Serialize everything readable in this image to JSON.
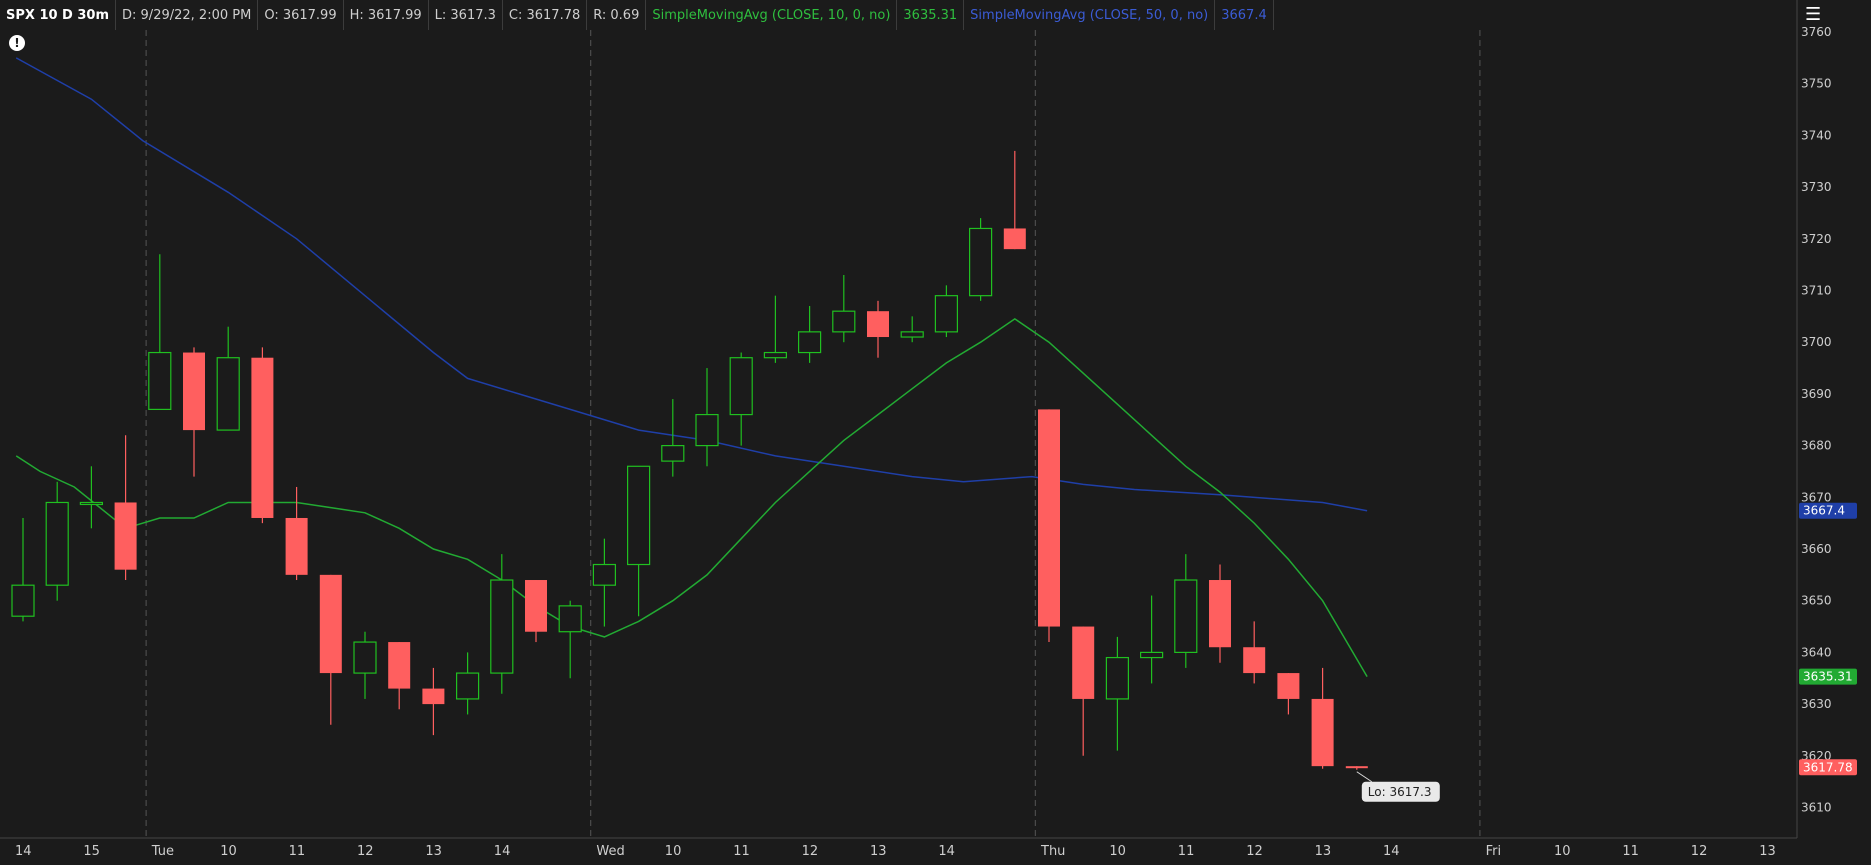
{
  "header": {
    "symbol": "SPX 10 D 30m",
    "date": "D: 9/29/22, 2:00 PM",
    "open": "O: 3617.99",
    "high": "H: 3617.99",
    "low": "L: 3617.3",
    "close": "C: 3617.78",
    "range": "R: 0.69",
    "sma10_label": "SimpleMovingAvg (CLOSE, 10, 0, no)",
    "sma10_value": "3635.31",
    "sma50_label": "SimpleMovingAvg (CLOSE, 50, 0, no)",
    "sma50_value": "3667.4"
  },
  "icons": {
    "alert": "exclamation-icon",
    "menu": "menu-icon"
  },
  "colors": {
    "up": "#20c020",
    "down": "#ff5f5f",
    "sma10": "#22aa33",
    "sma50": "#1f3fa8",
    "grid": "#555555",
    "background": "#1b1b1b"
  },
  "chart_data": {
    "type": "candlestick",
    "y_ticks": [
      3610,
      3620,
      3630,
      3640,
      3650,
      3660,
      3670,
      3680,
      3690,
      3700,
      3710,
      3720,
      3730,
      3740,
      3750,
      3760
    ],
    "ylim": [
      3606,
      3762
    ],
    "x_ticks": [
      {
        "label": "14",
        "slot": 0
      },
      {
        "label": "15",
        "slot": 2
      },
      {
        "label": "Tue",
        "slot": 4
      },
      {
        "label": "10",
        "slot": 6
      },
      {
        "label": "11",
        "slot": 8
      },
      {
        "label": "12",
        "slot": 10
      },
      {
        "label": "13",
        "slot": 12
      },
      {
        "label": "14",
        "slot": 14
      },
      {
        "label": "Wed",
        "slot": 17
      },
      {
        "label": "10",
        "slot": 19
      },
      {
        "label": "11",
        "slot": 21
      },
      {
        "label": "12",
        "slot": 23
      },
      {
        "label": "13",
        "slot": 25
      },
      {
        "label": "14",
        "slot": 27
      },
      {
        "label": "Thu",
        "slot": 30
      },
      {
        "label": "10",
        "slot": 32
      },
      {
        "label": "11",
        "slot": 34
      },
      {
        "label": "12",
        "slot": 36
      },
      {
        "label": "13",
        "slot": 38
      },
      {
        "label": "14",
        "slot": 40
      },
      {
        "label": "Fri",
        "slot": 43
      },
      {
        "label": "10",
        "slot": 45
      },
      {
        "label": "11",
        "slot": 47
      },
      {
        "label": "12",
        "slot": 49
      },
      {
        "label": "13",
        "slot": 51
      }
    ],
    "day_separators": [
      3.6,
      16.6,
      29.6,
      42.6
    ],
    "candles": [
      {
        "o": 3647,
        "h": 3666,
        "l": 3646,
        "c": 3653
      },
      {
        "o": 3653,
        "h": 3673,
        "l": 3650,
        "c": 3669
      },
      {
        "o": 3669,
        "h": 3676,
        "l": 3664,
        "c": 3669
      },
      {
        "o": 3669,
        "h": 3682,
        "l": 3654,
        "c": 3656
      },
      {
        "o": 3687,
        "h": 3717,
        "l": 3687,
        "c": 3698
      },
      {
        "o": 3698,
        "h": 3699,
        "l": 3674,
        "c": 3683
      },
      {
        "o": 3683,
        "h": 3703,
        "l": 3683,
        "c": 3697
      },
      {
        "o": 3697,
        "h": 3699,
        "l": 3665,
        "c": 3666
      },
      {
        "o": 3666,
        "h": 3672,
        "l": 3654,
        "c": 3655
      },
      {
        "o": 3655,
        "h": 3655,
        "l": 3626,
        "c": 3636
      },
      {
        "o": 3636,
        "h": 3644,
        "l": 3631,
        "c": 3642
      },
      {
        "o": 3642,
        "h": 3642,
        "l": 3629,
        "c": 3633
      },
      {
        "o": 3633,
        "h": 3637,
        "l": 3624,
        "c": 3630
      },
      {
        "o": 3631,
        "h": 3640,
        "l": 3628,
        "c": 3636
      },
      {
        "o": 3636,
        "h": 3659,
        "l": 3632,
        "c": 3654
      },
      {
        "o": 3654,
        "h": 3654,
        "l": 3642,
        "c": 3644
      },
      {
        "o": 3644,
        "h": 3650,
        "l": 3635,
        "c": 3649
      },
      {
        "o": 3653,
        "h": 3662,
        "l": 3645,
        "c": 3657
      },
      {
        "o": 3657,
        "h": 3676,
        "l": 3647,
        "c": 3676
      },
      {
        "o": 3677,
        "h": 3689,
        "l": 3674,
        "c": 3680
      },
      {
        "o": 3680,
        "h": 3695,
        "l": 3676,
        "c": 3686
      },
      {
        "o": 3686,
        "h": 3698,
        "l": 3680,
        "c": 3697
      },
      {
        "o": 3697,
        "h": 3709,
        "l": 3696,
        "c": 3698
      },
      {
        "o": 3698,
        "h": 3707,
        "l": 3696,
        "c": 3702
      },
      {
        "o": 3702,
        "h": 3713,
        "l": 3700,
        "c": 3706
      },
      {
        "o": 3706,
        "h": 3708,
        "l": 3697,
        "c": 3701
      },
      {
        "o": 3701,
        "h": 3705,
        "l": 3700,
        "c": 3702
      },
      {
        "o": 3702,
        "h": 3711,
        "l": 3701,
        "c": 3709
      },
      {
        "o": 3709,
        "h": 3724,
        "l": 3708,
        "c": 3722
      },
      {
        "o": 3722,
        "h": 3737,
        "l": 3718,
        "c": 3718
      },
      {
        "o": 3687,
        "h": 3687,
        "l": 3642,
        "c": 3645
      },
      {
        "o": 3645,
        "h": 3645,
        "l": 3620,
        "c": 3631
      },
      {
        "o": 3631,
        "h": 3643,
        "l": 3621,
        "c": 3639
      },
      {
        "o": 3639,
        "h": 3651,
        "l": 3634,
        "c": 3640
      },
      {
        "o": 3640,
        "h": 3659,
        "l": 3637,
        "c": 3654
      },
      {
        "o": 3654,
        "h": 3657,
        "l": 3638,
        "c": 3641
      },
      {
        "o": 3641,
        "h": 3646,
        "l": 3634,
        "c": 3636
      },
      {
        "o": 3636,
        "h": 3636,
        "l": 3628,
        "c": 3631
      },
      {
        "o": 3631,
        "h": 3637,
        "l": 3617.5,
        "c": 3618
      },
      {
        "o": 3617.99,
        "h": 3617.99,
        "l": 3617.3,
        "c": 3617.78
      }
    ],
    "sma10": [
      3678,
      3676,
      3673,
      3670,
      3666,
      3666,
      3669,
      3669,
      3668,
      3667,
      3664,
      3660,
      3658,
      3654,
      3649,
      3645,
      3643,
      3642,
      3646,
      3654,
      3663,
      3674,
      3683,
      3691,
      3698,
      3702,
      3704,
      3702,
      3697,
      3691,
      3685,
      3679,
      3673,
      3664,
      3656,
      3646,
      3635.31
    ],
    "sma10_start_slot": 0,
    "sma50": [
      3756,
      3752,
      3746,
      3740,
      3735,
      3730,
      3724,
      3718,
      3712,
      3705,
      3699,
      3693,
      3688,
      3685,
      3682,
      3679,
      3676,
      3674,
      3672,
      3670,
      3668,
      3666,
      3664,
      3664,
      3665,
      3664,
      3663,
      3662,
      3661,
      3660,
      3667.4
    ],
    "sma50_points": [
      {
        "slot": -0.2,
        "v": 3755
      },
      {
        "slot": 2.0,
        "v": 3747
      },
      {
        "slot": 3.5,
        "v": 3739
      },
      {
        "slot": 6.0,
        "v": 3729
      },
      {
        "slot": 8.0,
        "v": 3720
      },
      {
        "slot": 10.0,
        "v": 3709
      },
      {
        "slot": 12.0,
        "v": 3698
      },
      {
        "slot": 13.0,
        "v": 3693
      },
      {
        "slot": 14.5,
        "v": 3690
      },
      {
        "slot": 16.0,
        "v": 3687
      },
      {
        "slot": 18.0,
        "v": 3683
      },
      {
        "slot": 20.0,
        "v": 3681
      },
      {
        "slot": 22.0,
        "v": 3678
      },
      {
        "slot": 24.0,
        "v": 3676
      },
      {
        "slot": 26.0,
        "v": 3674
      },
      {
        "slot": 27.5,
        "v": 3673
      },
      {
        "slot": 29.5,
        "v": 3674
      },
      {
        "slot": 31.0,
        "v": 3672.5
      },
      {
        "slot": 32.5,
        "v": 3671.5
      },
      {
        "slot": 35.0,
        "v": 3670.5
      },
      {
        "slot": 38.0,
        "v": 3669
      },
      {
        "slot": 39.3,
        "v": 3667.4
      }
    ],
    "sma10_points": [
      {
        "slot": -0.2,
        "v": 3678
      },
      {
        "slot": 0.5,
        "v": 3675
      },
      {
        "slot": 1.5,
        "v": 3672
      },
      {
        "slot": 3.0,
        "v": 3664
      },
      {
        "slot": 4.0,
        "v": 3666
      },
      {
        "slot": 5.0,
        "v": 3666
      },
      {
        "slot": 6.0,
        "v": 3669
      },
      {
        "slot": 7.0,
        "v": 3669
      },
      {
        "slot": 8.0,
        "v": 3669
      },
      {
        "slot": 9.0,
        "v": 3668
      },
      {
        "slot": 10.0,
        "v": 3667
      },
      {
        "slot": 11.0,
        "v": 3664
      },
      {
        "slot": 12.0,
        "v": 3660
      },
      {
        "slot": 13.0,
        "v": 3658
      },
      {
        "slot": 14.0,
        "v": 3654
      },
      {
        "slot": 15.0,
        "v": 3649
      },
      {
        "slot": 16.0,
        "v": 3645
      },
      {
        "slot": 17.0,
        "v": 3643
      },
      {
        "slot": 18.0,
        "v": 3646
      },
      {
        "slot": 19.0,
        "v": 3650
      },
      {
        "slot": 20.0,
        "v": 3655
      },
      {
        "slot": 21.0,
        "v": 3662
      },
      {
        "slot": 22.0,
        "v": 3669
      },
      {
        "slot": 23.0,
        "v": 3675
      },
      {
        "slot": 24.0,
        "v": 3681
      },
      {
        "slot": 25.0,
        "v": 3686
      },
      {
        "slot": 26.0,
        "v": 3691
      },
      {
        "slot": 27.0,
        "v": 3696
      },
      {
        "slot": 28.0,
        "v": 3700
      },
      {
        "slot": 29.0,
        "v": 3704.5
      },
      {
        "slot": 30.0,
        "v": 3700
      },
      {
        "slot": 31.0,
        "v": 3694
      },
      {
        "slot": 32.0,
        "v": 3688
      },
      {
        "slot": 33.0,
        "v": 3682
      },
      {
        "slot": 34.0,
        "v": 3676
      },
      {
        "slot": 35.0,
        "v": 3671
      },
      {
        "slot": 36.0,
        "v": 3665
      },
      {
        "slot": 37.0,
        "v": 3658
      },
      {
        "slot": 38.0,
        "v": 3650
      },
      {
        "slot": 39.3,
        "v": 3635.31
      }
    ],
    "price_labels": [
      {
        "name": "sma50-price-label",
        "value": "3667.4",
        "v": 3667.4,
        "color": "#1f3fa8"
      },
      {
        "name": "sma10-price-label",
        "value": "3635.31",
        "v": 3635.31,
        "color": "#22aa33"
      },
      {
        "name": "last-price-label",
        "value": "3617.78",
        "v": 3617.78,
        "color": "#ff5f5f"
      }
    ],
    "low_bubble": {
      "text": "Lo: 3617.3",
      "v": 3617.3,
      "slot": 39
    }
  }
}
